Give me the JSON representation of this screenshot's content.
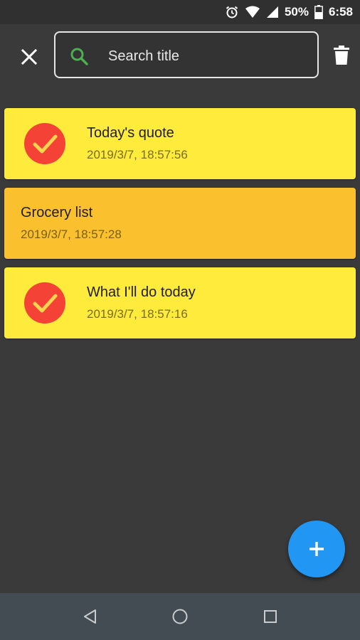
{
  "status_bar": {
    "battery_percent": "50%",
    "time": "6:58",
    "icons": [
      "alarm-icon",
      "wifi-icon",
      "signal-icon",
      "battery-icon"
    ]
  },
  "app_bar": {
    "close_icon": "close-icon",
    "search": {
      "placeholder": "Search title",
      "value": "",
      "icon": "search-icon"
    },
    "delete_icon": "trash-icon"
  },
  "notes": [
    {
      "title": "Today's quote",
      "date": "2019/3/7, 18:57:56",
      "checked": true,
      "color": "#ffeb3b"
    },
    {
      "title": "Grocery list",
      "date": "2019/3/7, 18:57:28",
      "checked": false,
      "color": "#fbc02d"
    },
    {
      "title": "What I'll do today",
      "date": "2019/3/7, 18:57:16",
      "checked": true,
      "color": "#ffeb3b"
    }
  ],
  "fab": {
    "icon": "plus-icon",
    "color": "#2196f3"
  },
  "nav_bar": {
    "icons": [
      "back-icon",
      "home-icon",
      "recents-icon"
    ]
  },
  "colors": {
    "background": "#3a3a3a",
    "check_circle": "#f44336",
    "search_icon": "#4caf50"
  }
}
